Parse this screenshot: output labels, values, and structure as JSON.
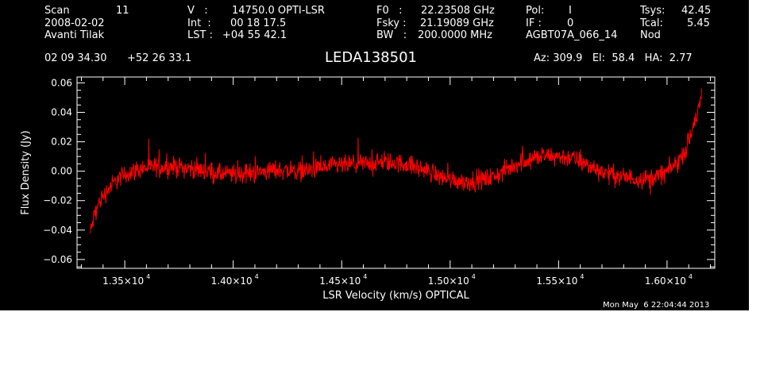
{
  "header": {
    "scan_label": "Scan",
    "scan_value": "11",
    "date": "2008-02-02",
    "observer": "Avanti Tilak",
    "v_label": "V   :",
    "v_value": "14750.0 OPTI-LSR",
    "int_label": "Int  :",
    "int_value": "00 18 17.5",
    "lst_label": "LST :",
    "lst_value": "+04 55 42.1",
    "f0_label": "F0   :",
    "f0_value": "22.23508 GHz",
    "fsky_label": "Fsky :",
    "fsky_value": "21.19089 GHz",
    "bw_label": "BW   :",
    "bw_value": "200.0000 MHz",
    "pol_label": "Pol:",
    "pol_value": "I",
    "if_label": "IF :",
    "if_value": "0",
    "project": "AGBT07A_066_14",
    "tsys_label": "Tsys:",
    "tsys_value": "42.45",
    "tcal_label": "Tcal:",
    "tcal_value": "5.45",
    "mode": "Nod",
    "ra": "02 09 34.30",
    "dec": "+52 26 33.1",
    "source": "LEDA138501",
    "az_el_ha": "Az: 309.9   El:  58.4   HA:  2.77"
  },
  "timestamp": "Mon May  6 22:04:44 2013",
  "chart_data": {
    "type": "line",
    "xlabel": "LSR Velocity (km/s) OPTICAL",
    "ylabel": "Flux Density (Jy)",
    "xlim": [
      13280,
      16220
    ],
    "ylim": [
      -0.066,
      0.064
    ],
    "xticks": [
      13500,
      14000,
      14500,
      15000,
      15500,
      16000
    ],
    "xtick_mantissa": [
      "1.35",
      "1.40",
      "1.45",
      "1.50",
      "1.55",
      "1.60"
    ],
    "xtick_exponent": "4",
    "yticks": [
      -0.06,
      -0.04,
      -0.02,
      0.0,
      0.02,
      0.04,
      0.06
    ],
    "ytick_labels": [
      "−0.06",
      "−0.04",
      "−0.02",
      "0.00",
      "0.02",
      "0.04",
      "0.06"
    ],
    "grid": false,
    "series": [
      {
        "color": "#ff0000",
        "x_start": 13340,
        "x_end": 16160,
        "noise_amplitude": 0.0065,
        "x": [
          13340,
          13360,
          13380,
          13400,
          13430,
          13470,
          13520,
          13580,
          13650,
          13720,
          13800,
          13880,
          13950,
          14020,
          14100,
          14200,
          14300,
          14400,
          14500,
          14600,
          14700,
          14800,
          14900,
          14960,
          15020,
          15080,
          15140,
          15200,
          15260,
          15320,
          15380,
          15440,
          15500,
          15560,
          15620,
          15680,
          15740,
          15800,
          15860,
          15920,
          15980,
          16020,
          16060,
          16090,
          16110,
          16130,
          16150,
          16160
        ],
        "y": [
          -0.043,
          -0.03,
          -0.022,
          -0.017,
          -0.011,
          -0.005,
          -0.001,
          0.002,
          0.003,
          0.003,
          0.002,
          0.0,
          -0.002,
          -0.002,
          -0.001,
          0.001,
          0.0,
          0.002,
          0.004,
          0.005,
          0.006,
          0.005,
          0.0,
          -0.004,
          -0.006,
          -0.007,
          -0.006,
          -0.004,
          0.001,
          0.006,
          0.009,
          0.01,
          0.01,
          0.009,
          0.005,
          0.001,
          -0.002,
          -0.004,
          -0.005,
          -0.005,
          -0.002,
          0.002,
          0.008,
          0.016,
          0.025,
          0.035,
          0.045,
          0.05
        ]
      }
    ]
  }
}
